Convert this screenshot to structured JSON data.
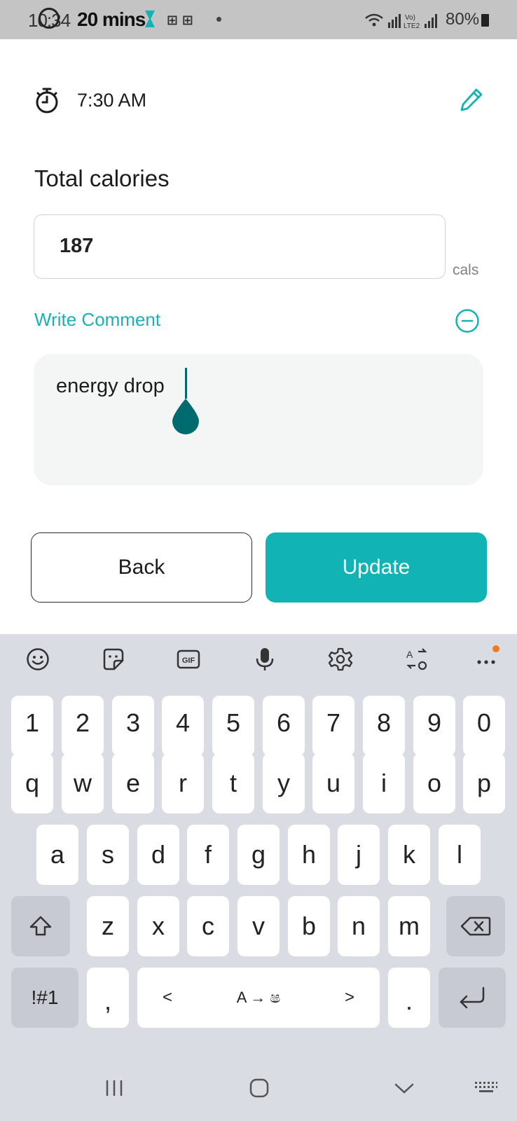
{
  "status_bar": {
    "time": "10:34",
    "promo_text": "20 mins",
    "battery": "80%"
  },
  "entry": {
    "time": "7:30 AM",
    "total_calories_title": "Total calories",
    "calories_value": "187",
    "calories_unit": "cals",
    "comment_label": "Write Comment",
    "comment_text": "energy drop",
    "back_label": "Back",
    "update_label": "Update"
  },
  "keyboard": {
    "toolbar_icons": [
      "emoji-icon",
      "sticker-icon",
      "gif-icon",
      "mic-icon",
      "settings-icon",
      "translate-icon",
      "more-icon"
    ],
    "row_numbers": [
      "1",
      "2",
      "3",
      "4",
      "5",
      "6",
      "7",
      "8",
      "9",
      "0"
    ],
    "row1": [
      "q",
      "w",
      "e",
      "r",
      "t",
      "y",
      "u",
      "i",
      "o",
      "p"
    ],
    "row2": [
      "a",
      "s",
      "d",
      "f",
      "g",
      "h",
      "j",
      "k",
      "l"
    ],
    "row3": [
      "z",
      "x",
      "c",
      "v",
      "b",
      "n",
      "m"
    ],
    "symbols_label": "!#1",
    "comma_label": ",",
    "left_arrow": "<",
    "space_label": "A → ෂ",
    "right_arrow": ">",
    "period_label": "."
  },
  "colors": {
    "accent": "#12b3b5",
    "cursor": "#006b6e",
    "keyboard_bg": "#d9dce3",
    "status_bar_bg": "#c4c4c4"
  }
}
